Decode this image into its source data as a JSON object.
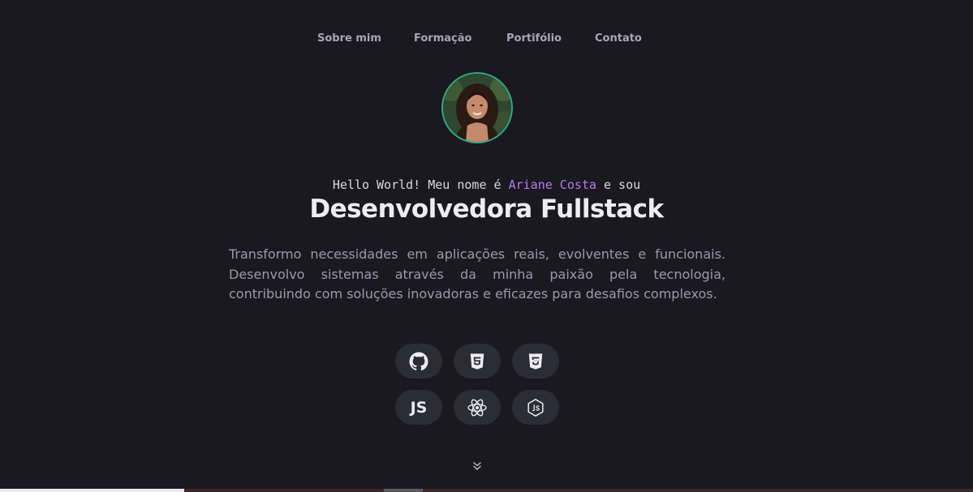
{
  "nav": {
    "items": [
      {
        "label": "Sobre mim"
      },
      {
        "label": "Formação"
      },
      {
        "label": "Portifólio"
      },
      {
        "label": "Contato"
      }
    ]
  },
  "hero": {
    "greeting_prefix": "Hello World! Meu nome é ",
    "name": "Ariane Costa",
    "greeting_suffix": " e sou",
    "title": "Desenvolvedora Fullstack",
    "description": "Transformo necessidades em aplicações reais, evolventes e funcionais. Desenvolvo sistemas através da minha paixão pela tecnologia, contribuindo com soluções inovadoras e eficazes para desafios complexos."
  },
  "skills": [
    {
      "icon": "github-icon"
    },
    {
      "icon": "html5-icon"
    },
    {
      "icon": "css3-icon"
    },
    {
      "icon": "javascript-icon",
      "text": "JS"
    },
    {
      "icon": "react-icon"
    },
    {
      "icon": "nodejs-icon"
    }
  ],
  "colors": {
    "background": "#19191f",
    "accent_name": "#b57cf0",
    "avatar_border": "#2ea88a",
    "skill_bg": "#2c2c36"
  },
  "scroll": {
    "icon": "double-chevron-down-icon"
  }
}
